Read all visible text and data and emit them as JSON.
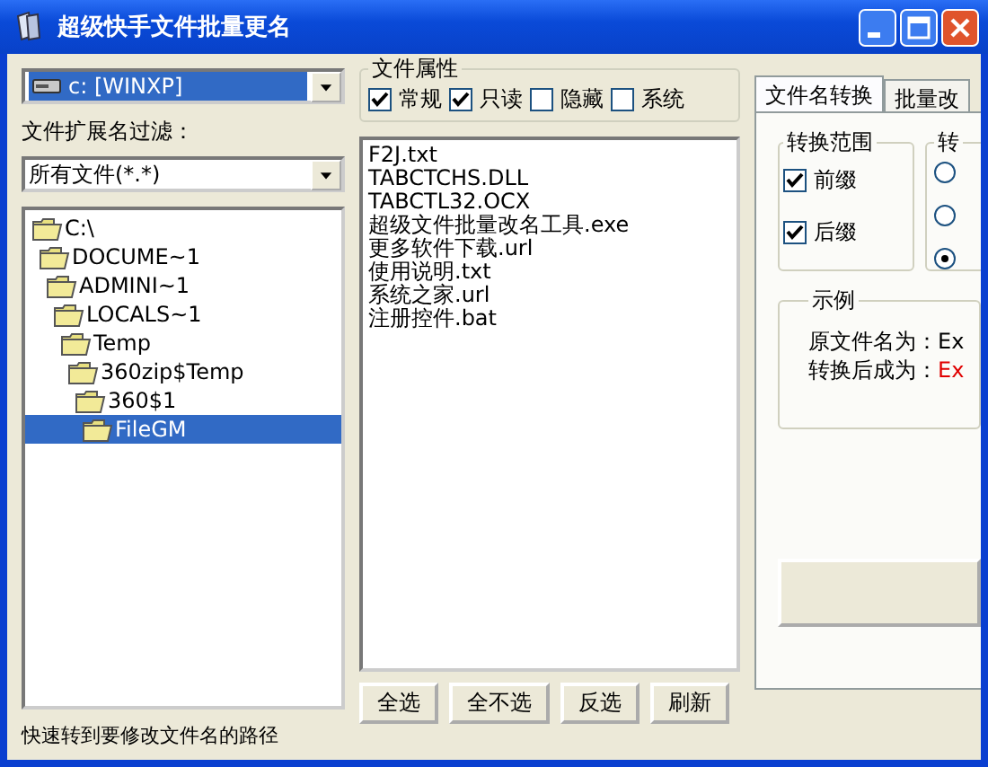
{
  "window": {
    "title": "超级快手文件批量更名"
  },
  "drive_combo": {
    "value": "c: [WINXP]"
  },
  "filter": {
    "label": "文件扩展名过滤：",
    "value": "所有文件(*.*)"
  },
  "folder_tree": [
    {
      "label": "C:\\",
      "selected": false,
      "children": [
        {
          "label": "DOCUME~1",
          "selected": false,
          "children": [
            {
              "label": "ADMINI~1",
              "selected": false,
              "children": [
                {
                  "label": "LOCALS~1",
                  "selected": false,
                  "children": [
                    {
                      "label": "Temp",
                      "selected": false,
                      "children": [
                        {
                          "label": "360zip$Temp",
                          "selected": false,
                          "children": [
                            {
                              "label": "360$1",
                              "selected": false,
                              "children": [
                                {
                                  "label": "FileGM",
                                  "selected": true
                                }
                              ]
                            }
                          ]
                        }
                      ]
                    }
                  ]
                }
              ]
            }
          ]
        }
      ]
    }
  ],
  "file_attributes": {
    "title": "文件属性",
    "options": [
      {
        "label": "常规",
        "checked": true
      },
      {
        "label": "只读",
        "checked": true
      },
      {
        "label": "隐藏",
        "checked": false
      },
      {
        "label": "系统",
        "checked": false
      }
    ]
  },
  "files": [
    "F2J.txt",
    "TABCTCHS.DLL",
    "TABCTL32.OCX",
    "超级文件批量改名工具.exe",
    "更多软件下载.url",
    "使用说明.txt",
    "系统之家.url",
    "注册控件.bat"
  ],
  "buttons": [
    "全选",
    "全不选",
    "反选",
    "刷新"
  ],
  "hint": "快速转到要修改文件名的路径",
  "tabs": [
    {
      "label": "文件名转换",
      "selected": true
    },
    {
      "label": "批量改",
      "selected": false
    }
  ],
  "scope": {
    "title": "转换范围",
    "options": [
      {
        "label": "前缀",
        "checked": true
      },
      {
        "label": "后缀",
        "checked": true
      }
    ]
  },
  "conversion": {
    "title": "转",
    "radios": [
      {
        "selected": false
      },
      {
        "selected": false
      },
      {
        "selected": true
      }
    ]
  },
  "example": {
    "title": "示例",
    "rows": [
      {
        "label": "原文件名为：",
        "value": "Ex",
        "kind": "original"
      },
      {
        "label": "转换后成为：",
        "value": "Ex",
        "kind": "converted"
      }
    ]
  }
}
